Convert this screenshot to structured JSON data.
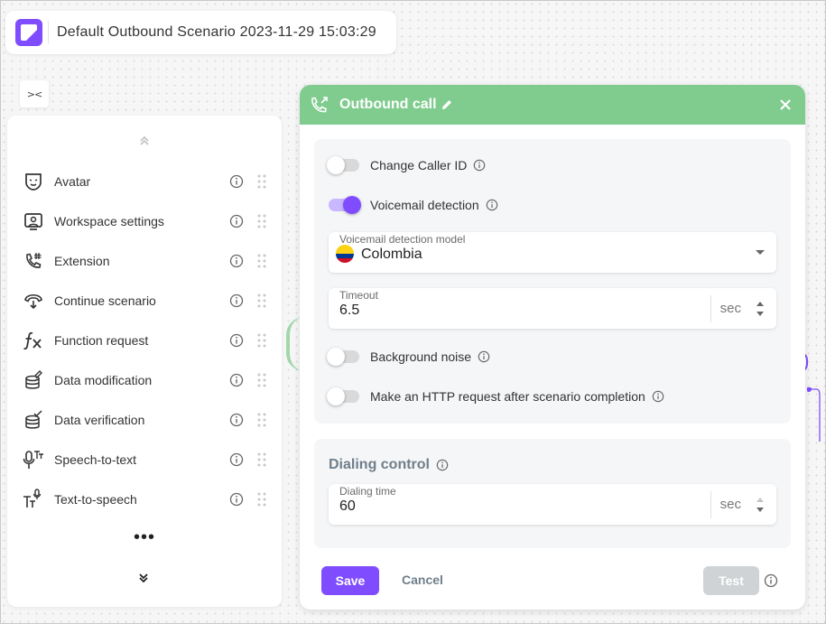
{
  "app": {
    "scenario_title": "Default Outbound Scenario 2023-11-29 15:03:29",
    "collapse_symbol": "><"
  },
  "sidebar": {
    "items": [
      {
        "label": "Avatar",
        "icon": "avatar-mask-icon"
      },
      {
        "label": "Workspace settings",
        "icon": "workspace-settings-icon"
      },
      {
        "label": "Extension",
        "icon": "phone-hash-icon"
      },
      {
        "label": "Continue scenario",
        "icon": "continue-scenario-icon"
      },
      {
        "label": "Function request",
        "icon": "function-fx-icon"
      },
      {
        "label": "Data modification",
        "icon": "database-edit-icon"
      },
      {
        "label": "Data verification",
        "icon": "database-check-icon"
      },
      {
        "label": "Speech-to-text",
        "icon": "microphone-text-icon"
      },
      {
        "label": "Text-to-speech",
        "icon": "text-microphone-icon"
      }
    ],
    "more_label": "•••"
  },
  "modal": {
    "title": "Outbound call",
    "header_color": "#7fcc8e",
    "toggles": [
      {
        "label": "Change Caller ID",
        "on": false
      },
      {
        "label": "Voicemail detection",
        "on": true
      },
      {
        "label": "Background noise",
        "on": false
      },
      {
        "label": "Make an HTTP request after scenario completion",
        "on": false
      }
    ],
    "vm_model": {
      "label": "Voicemail detection model",
      "value": "Colombia"
    },
    "timeout": {
      "label": "Timeout",
      "value": "6.5",
      "unit": "sec"
    },
    "dialing": {
      "title": "Dialing control",
      "label": "Dialing time",
      "value": "60",
      "unit": "sec"
    },
    "buttons": {
      "save": "Save",
      "cancel": "Cancel",
      "test": "Test"
    }
  },
  "colors": {
    "accent": "#7f4dff",
    "success": "#7fcc8e",
    "disabled": "#cfd3d6"
  }
}
